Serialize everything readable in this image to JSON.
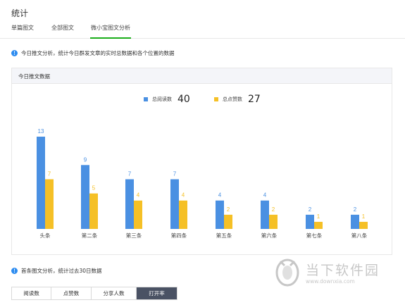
{
  "page": {
    "title": "统计"
  },
  "tabs": [
    {
      "label": "单篇图文"
    },
    {
      "label": "全部图文"
    },
    {
      "label": "微小宝图文分析",
      "active": true
    }
  ],
  "info1": {
    "text": "今日推文分析，统计今日群发文章的实时总数据和各个位置的数据"
  },
  "panel": {
    "title": "今日推文数据"
  },
  "legend": [
    {
      "label": "总阅读数",
      "total": "40",
      "color": "#4a90e2"
    },
    {
      "label": "总点赞数",
      "total": "27",
      "color": "#f5c026"
    }
  ],
  "chart_data": {
    "type": "bar",
    "categories": [
      "头条",
      "第二条",
      "第三条",
      "第四条",
      "第五条",
      "第六条",
      "第七条",
      "第八条"
    ],
    "series": [
      {
        "name": "总阅读数",
        "values": [
          13,
          9,
          7,
          7,
          4,
          4,
          2,
          2
        ],
        "color": "#4a90e2"
      },
      {
        "name": "总点赞数",
        "values": [
          7,
          5,
          4,
          4,
          2,
          2,
          1,
          1
        ],
        "color": "#f5c026"
      }
    ],
    "ylim": [
      0,
      13
    ],
    "grid": false,
    "legend_position": "top-center"
  },
  "info2": {
    "text": "首条图文分析，统计过去30日数据"
  },
  "buttons": [
    {
      "label": "阅读数"
    },
    {
      "label": "点赞数"
    },
    {
      "label": "分享人数"
    },
    {
      "label": "打开率",
      "active": true
    }
  ],
  "watermark": {
    "name": "当下软件园",
    "url": "www.downxia.com"
  }
}
